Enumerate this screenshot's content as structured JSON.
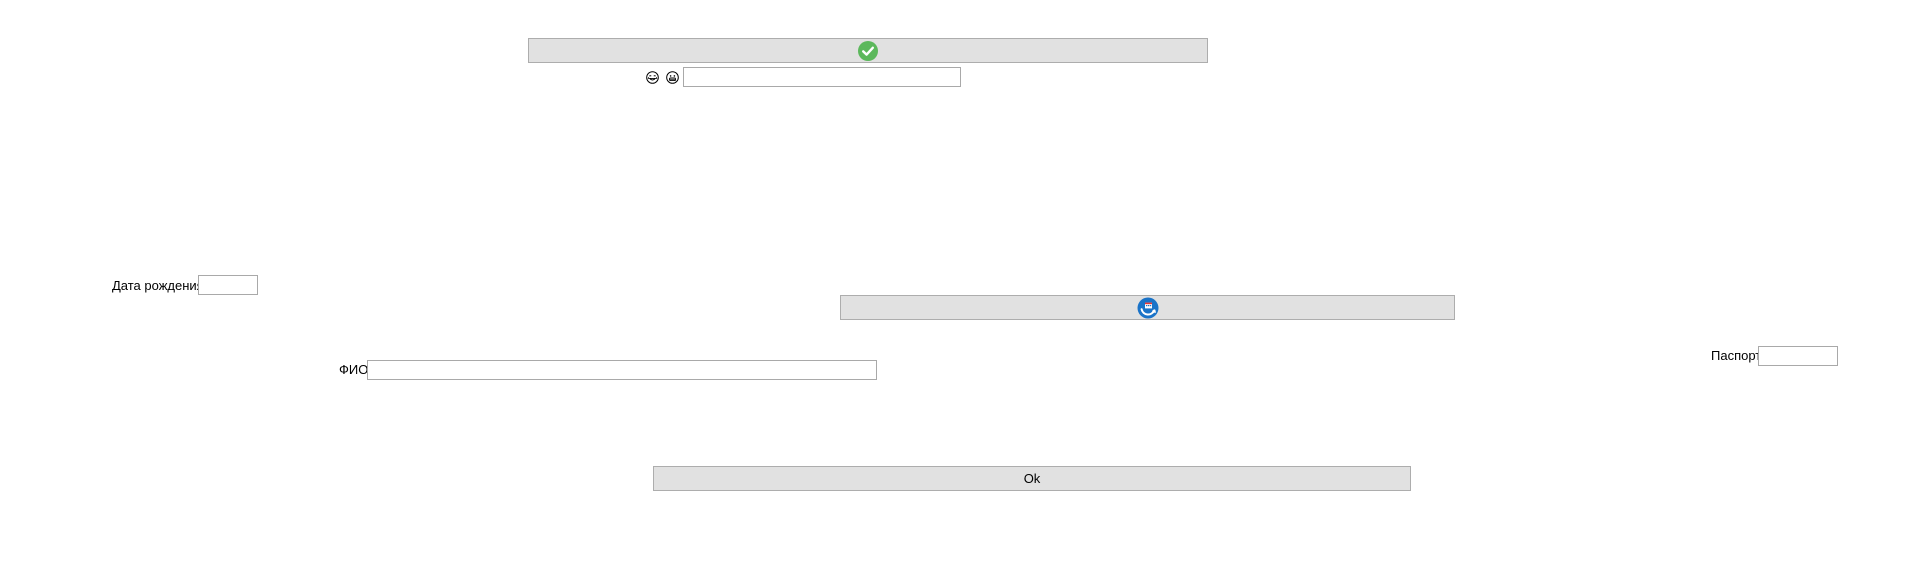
{
  "top": {
    "confirm_icon": "check-circle-icon",
    "confirm_icon_color": "#5cb85c",
    "emoji_left": "smiling-face-with-tears-icon",
    "emoji_right": "grinning-face-icon",
    "text_value": ""
  },
  "refresh": {
    "icon": "refresh-calendar-icon",
    "icon_color": "#1a73c8"
  },
  "birth_date": {
    "label": "Дата рождения",
    "value": ""
  },
  "passport": {
    "label": "Паспорт",
    "value": ""
  },
  "full_name": {
    "label": "ФИО",
    "value": ""
  },
  "ok_button": {
    "label": "Ok"
  },
  "colors": {
    "button_bg": "#e1e1e1",
    "button_border": "#adadad",
    "field_border": "#a9a9a9"
  }
}
